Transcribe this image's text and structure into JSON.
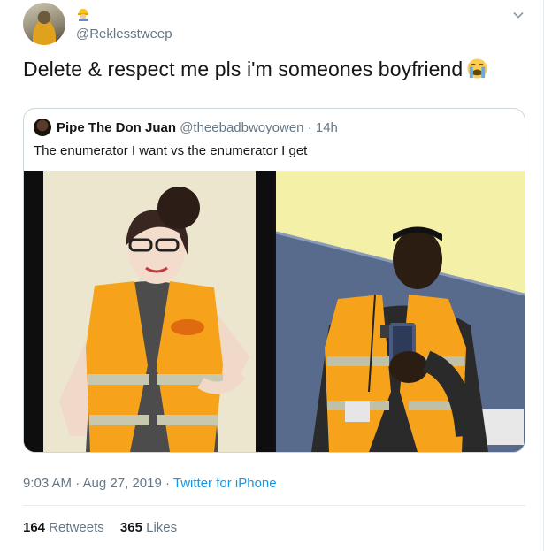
{
  "tweet": {
    "handle": "@Reklesstweep",
    "text": "Delete & respect me pls i'm someones boyfriend",
    "emoji": "loudly-crying-face",
    "name_emoji": "construction-worker",
    "timestamp": "9:03 AM · Aug 27, 2019",
    "source": "Twitter for iPhone",
    "retweets_count": "164",
    "retweets_label": "Retweets",
    "likes_count": "365",
    "likes_label": "Likes"
  },
  "quoted_tweet": {
    "name": "Pipe The Don Juan",
    "handle": "@theebadbwoyowen",
    "time": "14h",
    "text": "The enumerator I want vs the enumerator I get"
  },
  "colors": {
    "text": "#14171a",
    "secondary": "#657786",
    "link": "#1b95e0",
    "border": "#e6ecf0",
    "vest": "#f5a623"
  }
}
